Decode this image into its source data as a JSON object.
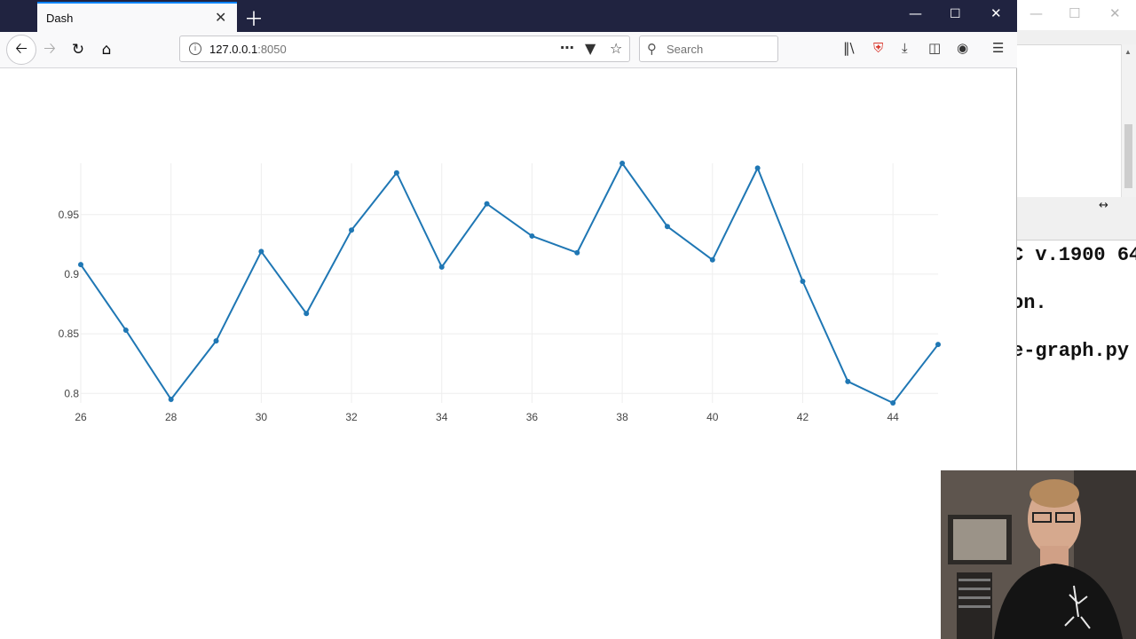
{
  "browser": {
    "tab_title": "Dash",
    "url_host": "127.0.0.1",
    "url_port": ":8050",
    "search_placeholder": "Search"
  },
  "background_window": {
    "code_lines": [
      "C v.1900 64",
      "on.",
      "e-graph.py"
    ]
  },
  "colors": {
    "line": "#1f77b4",
    "tab_bar": "#202340",
    "tab_accent": "#0a84ff"
  },
  "chart_data": {
    "type": "line",
    "title": "",
    "xlabel": "",
    "ylabel": "",
    "x": [
      26,
      27,
      28,
      29,
      30,
      31,
      32,
      33,
      34,
      35,
      36,
      37,
      38,
      39,
      40,
      41,
      42,
      43,
      44,
      45
    ],
    "y": [
      0.908,
      0.853,
      0.795,
      0.844,
      0.919,
      0.867,
      0.937,
      0.985,
      0.906,
      0.959,
      0.932,
      0.918,
      0.993,
      0.94,
      0.912,
      0.989,
      0.894,
      0.81,
      0.792,
      0.841
    ],
    "xlim": [
      26,
      45
    ],
    "ylim": [
      0.792,
      0.993
    ],
    "xticks": [
      26,
      28,
      30,
      32,
      34,
      36,
      38,
      40,
      42,
      44
    ],
    "xtick_labels": [
      "26",
      "28",
      "30",
      "32",
      "34",
      "36",
      "38",
      "40",
      "42",
      "44"
    ],
    "yticks": [
      0.8,
      0.85,
      0.9,
      0.95
    ],
    "ytick_labels": [
      "0.8",
      "0.85",
      "0.9",
      "0.95"
    ],
    "grid": true,
    "markers": true
  }
}
